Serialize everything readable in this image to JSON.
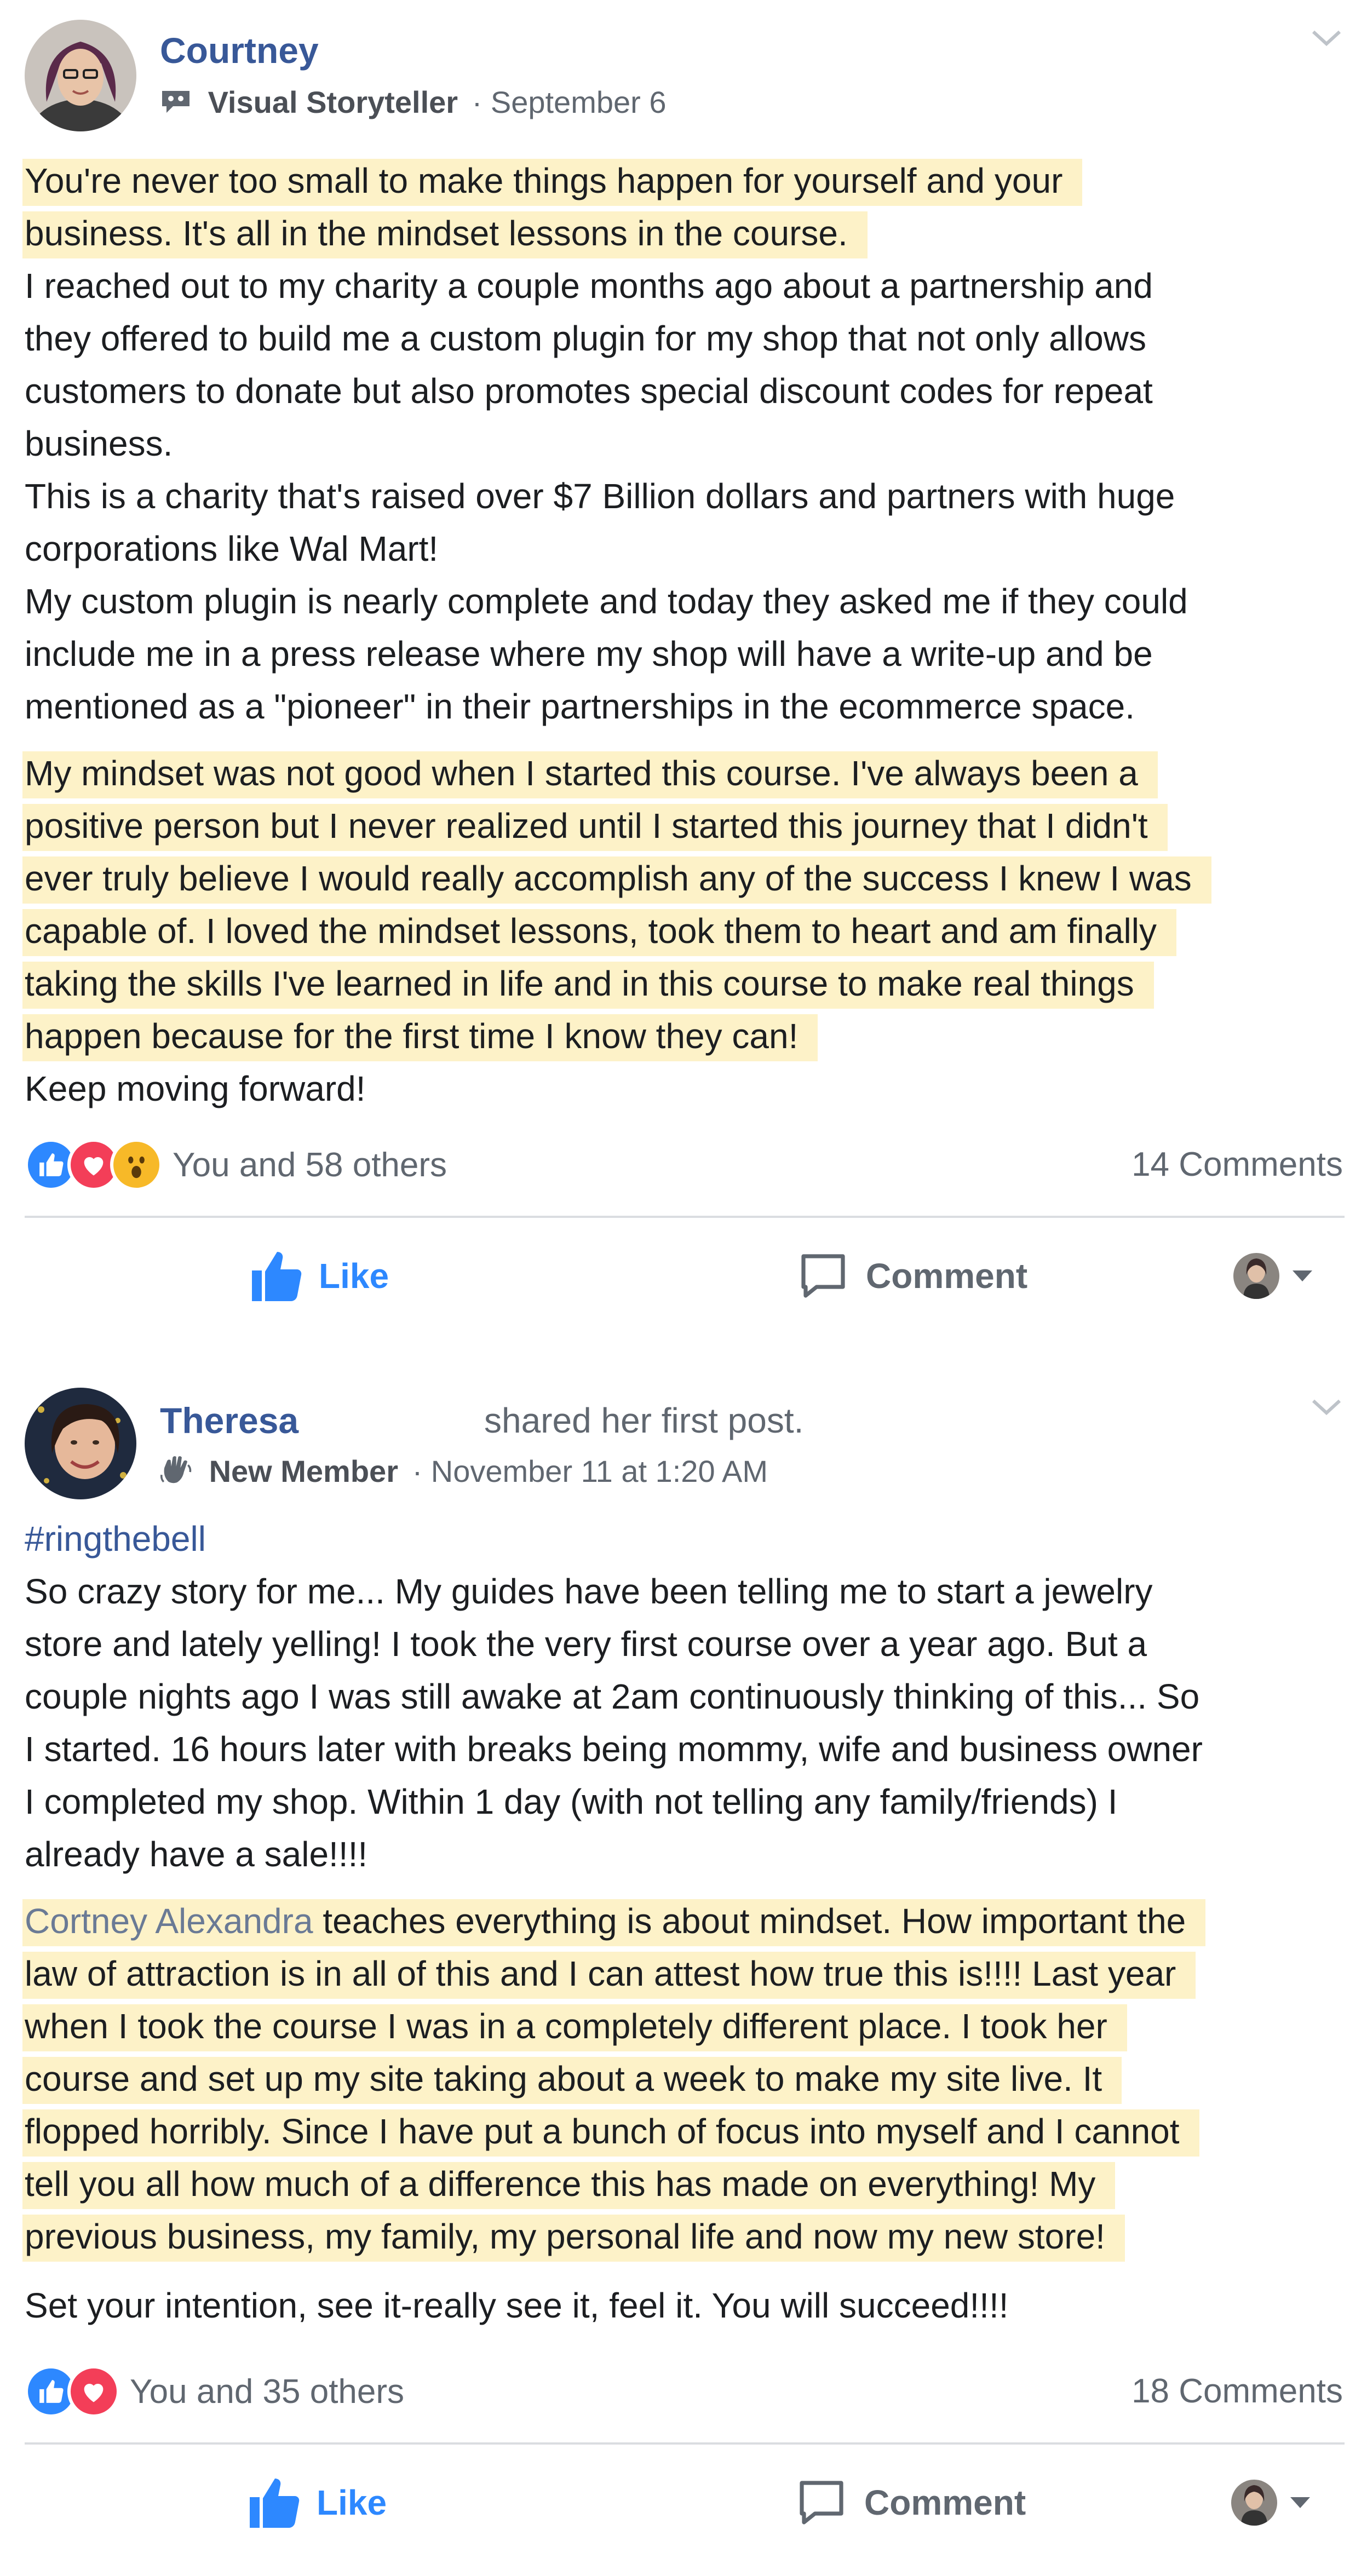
{
  "posts": [
    {
      "author": "Courtney",
      "shared_text": "",
      "badge": "Visual Storyteller",
      "date": "· September 6",
      "lines": [
        {
          "text": "You're never too small to make things happen for yourself and your",
          "highlight": true
        },
        {
          "text": "business. It's all in the mindset lessons in the course.",
          "highlight": true
        },
        {
          "text": "I reached out to my charity a couple months ago about a partnership and"
        },
        {
          "text": "they offered to build me a custom plugin for my shop that not only allows"
        },
        {
          "text": "customers to donate but also promotes special discount codes for repeat"
        },
        {
          "text": "business."
        },
        {
          "text": "This is a charity that's raised over $7 Billion dollars and partners with huge"
        },
        {
          "text": "corporations like Wal Mart!"
        },
        {
          "text": "My custom plugin is nearly complete and today they asked me if they could"
        },
        {
          "text": "include me in a press release where my shop will have a write-up and be"
        },
        {
          "text": "mentioned as a \"pioneer\" in their partnerships in the ecommerce space."
        },
        {
          "text": "My mindset was not good when I started this course. I've always been a",
          "highlight": true
        },
        {
          "text": "positive person but I never realized until I started this journey that I didn't",
          "highlight": true
        },
        {
          "text": "ever truly believe I would really accomplish any of the success I knew I was",
          "highlight": true
        },
        {
          "text": "capable of. I loved the mindset lessons, took them to heart and am finally",
          "highlight": true
        },
        {
          "text": "taking the skills I've learned in life and in this course to make real things",
          "highlight": true
        },
        {
          "text": "happen because for the first time I know they can!",
          "highlight": true
        },
        {
          "text": "Keep moving forward!"
        }
      ],
      "reactions_text": "You and 58 others",
      "reaction_icons": [
        "like-icon",
        "love-icon",
        "wow-icon"
      ],
      "comments": "14 Comments",
      "like_label": "Like",
      "comment_label": "Comment"
    },
    {
      "author": "Theresa",
      "shared_text": "shared her first post.",
      "badge": "New Member",
      "date": "· November 11 at 1:20 AM",
      "lines": [
        {
          "text": "#ringthebell",
          "hashtag": true
        },
        {
          "text": "So crazy story for me... My guides have been telling me to start a jewelry"
        },
        {
          "text": "store and lately yelling! I took the very first course over a year ago. But a"
        },
        {
          "text": "couple nights ago I was still awake at 2am continuously thinking of this... So"
        },
        {
          "text": "I started. 16 hours later with breaks being mommy, wife and business owner"
        },
        {
          "text": "I completed my shop. Within 1 day (with not telling any family/friends) I"
        },
        {
          "text": "already have a sale!!!!"
        },
        {
          "mention": "Cortney Alexandra",
          "text": " teaches everything is about mindset. How important the",
          "highlight": true
        },
        {
          "text": "law of attraction is in all of this and I can attest how true this is!!!! Last year",
          "highlight": true
        },
        {
          "text": "when I took the course I was in a completely different place. I took her",
          "highlight": true
        },
        {
          "text": "course and set up my site taking about a week to make my site live. It",
          "highlight": true
        },
        {
          "text": "flopped horribly. Since I have put a bunch of focus into myself and I cannot",
          "highlight": true
        },
        {
          "text": "tell you all how much of a difference this has made on everything! My",
          "highlight": true
        },
        {
          "text": "previous business, my family, my personal life and now my new store!",
          "highlight": true
        },
        {
          "text": "Set your intention, see it-really see it, feel it. You will succeed!!!!"
        }
      ],
      "reactions_text": "You and 35 others",
      "reaction_icons": [
        "like-icon",
        "love-icon"
      ],
      "comments": "18 Comments",
      "like_label": "Like",
      "comment_label": "Comment"
    }
  ],
  "colors": {
    "link": "#385898",
    "highlight": "#fdf2c8",
    "like_blue": "#2d88ff",
    "love_red": "#f33e58",
    "wow_yellow": "#f7b928",
    "meta_gray": "#606770"
  }
}
